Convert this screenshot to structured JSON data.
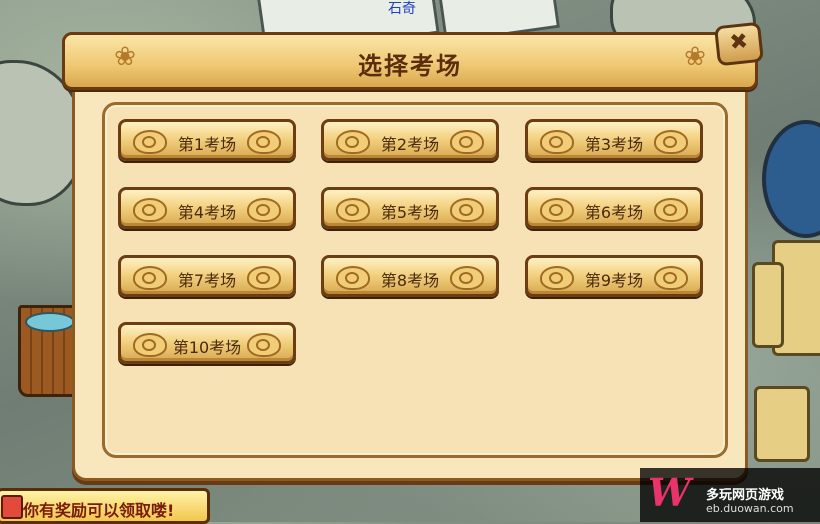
{
  "scene": {
    "top_name": "石奇"
  },
  "dialog": {
    "title": "选择考场",
    "close_icon": "close-x-icon",
    "exam_rooms": [
      {
        "label": "第1考场"
      },
      {
        "label": "第2考场"
      },
      {
        "label": "第3考场"
      },
      {
        "label": "第4考场"
      },
      {
        "label": "第5考场"
      },
      {
        "label": "第6考场"
      },
      {
        "label": "第7考场"
      },
      {
        "label": "第8考场"
      },
      {
        "label": "第9考场"
      },
      {
        "label": "第10考场"
      }
    ]
  },
  "reward_bar": {
    "text": "你有奖励可以领取喽!"
  },
  "watermark": {
    "logo": "W",
    "name": "多玩网页游戏",
    "url": "eb.duowan.com"
  },
  "colors": {
    "frame_brown": "#6a3a12",
    "panel_cream": "#f7e2b6",
    "button_gold": "#f3d282"
  }
}
